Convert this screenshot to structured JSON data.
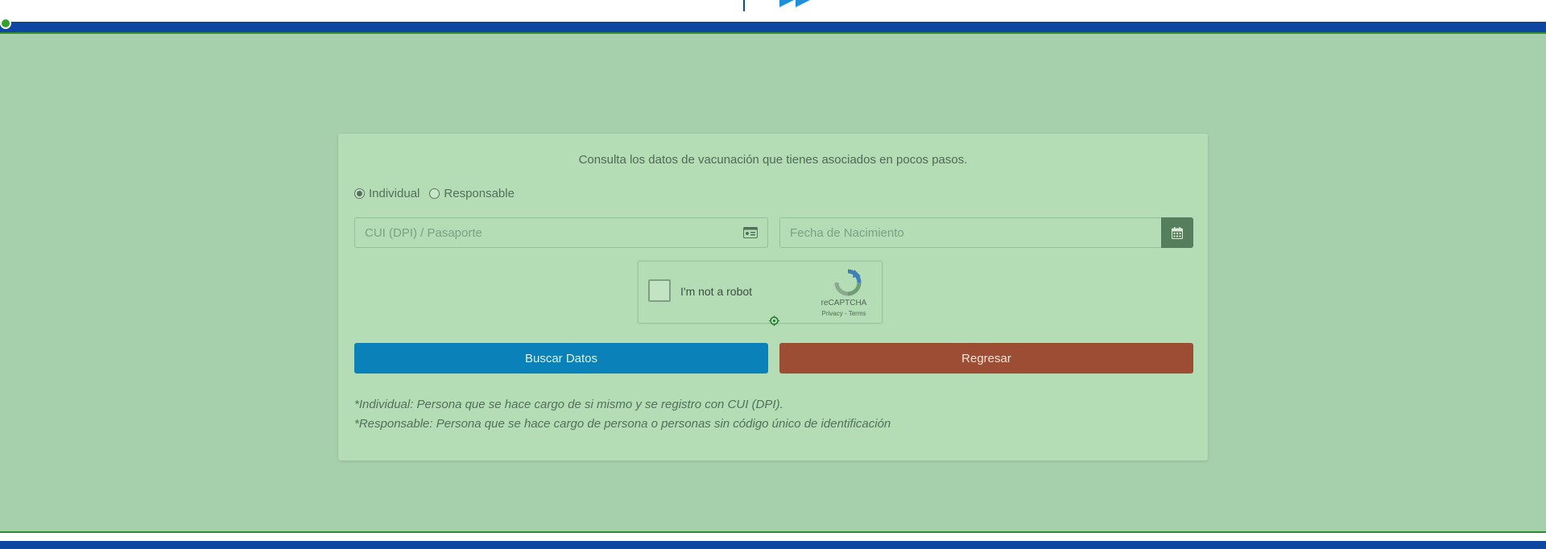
{
  "header": {
    "top_color": "#ffffff",
    "bar_color": "#0d47a1",
    "logo_icon": "play-triangles-logo"
  },
  "overlay": {
    "color": "#a6cfab",
    "border_color": "#2e8b2e"
  },
  "form": {
    "intro": "Consulta los datos de vacunación que tienes asociados en pocos pasos.",
    "radio_individual": "Individual",
    "radio_responsable": "Responsable",
    "selected_radio": "Individual",
    "cui_placeholder": "CUI (DPI) / Pasaporte",
    "cui_icon": "id-card-icon",
    "date_placeholder": "Fecha de Nacimiento",
    "date_icon": "calendar-icon",
    "captcha_label": "I'm not a robot",
    "captcha_brand": "reCAPTCHA",
    "captcha_links": "Privacy - Terms",
    "search_button": "Buscar Datos",
    "back_button": "Regresar",
    "note_individual": "*Individual: Persona que se hace cargo de si mismo y se registro con CUI (DPI).",
    "note_responsable": "*Responsable: Persona que se hace cargo de persona o personas sin código único de identificación"
  },
  "colors": {
    "search_button": "#0a82b9",
    "back_button": "#9d4d33",
    "calendar_button": "#557f5c",
    "card": "#b4dcb5"
  }
}
